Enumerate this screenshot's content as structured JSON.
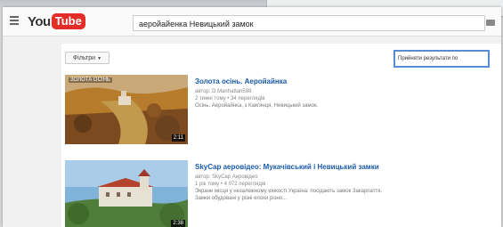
{
  "header": {
    "logo_you": "You",
    "logo_tube": "Tube",
    "search_value": "аеройайенка Невицький замок"
  },
  "toolbar": {
    "filter_label": "Фільтри",
    "promo_label": "Прийняти результати по"
  },
  "videos": [
    {
      "title": "Золота осінь. Аеройайнка",
      "channel": "автор: D.Manhattan598",
      "stats": "2 тижні тому • 34 переглядів",
      "description": "Осінь. Аеройайнка, з Кам'янця, Невицький замок.",
      "duration": "2:11",
      "thumb_overlay": "ЗОЛОТА ОСІНЬ"
    },
    {
      "title": "SkyCap аеровідео: Мукачівський і Невицький замки",
      "channel": "автор: SkyCap Аеровідео",
      "stats": "1 рік тому • 4 072 переглядів",
      "description": "Экране місця у незалежному юнкості Україна: посідають замок Закарпаття.",
      "description2": "Замки обудовані у різні епохи різно...",
      "duration": "2:38",
      "thumb_overlay": ""
    }
  ],
  "colors": {
    "logo_red": "#e52d27",
    "link_blue": "#1a5aa8",
    "focus_blue": "#5a8cd6"
  }
}
